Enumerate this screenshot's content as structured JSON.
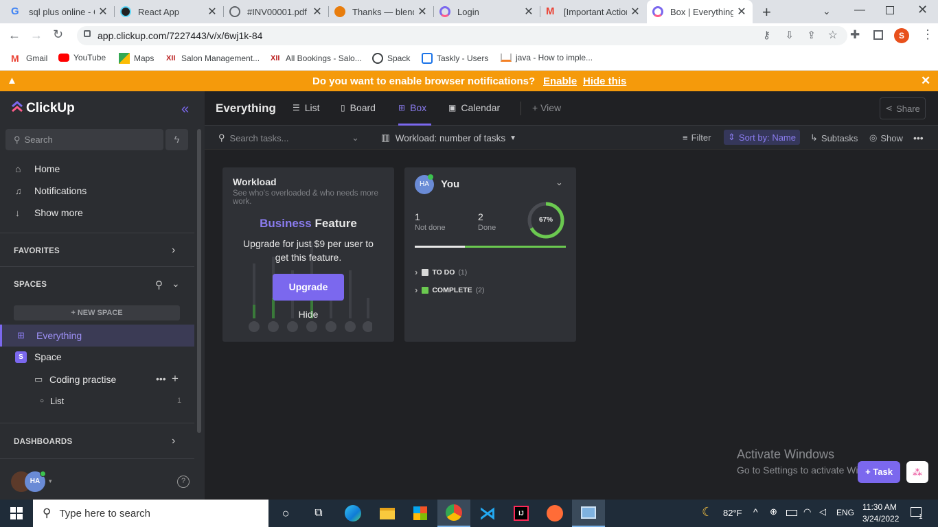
{
  "browser": {
    "tabs": [
      {
        "title": "sql plus online - C",
        "color": "#4285f4"
      },
      {
        "title": "React App",
        "color": "#61dafb"
      },
      {
        "title": "#INV00001.pdf",
        "color": "#5f6368"
      },
      {
        "title": "Thanks — blende",
        "color": "#e87d0d"
      },
      {
        "title": "Login",
        "color": "#7b68ee"
      },
      {
        "title": "[Important Action",
        "color": "#ea4335"
      },
      {
        "title": "Box | Everything |",
        "color": "#7b68ee"
      }
    ],
    "url": "app.clickup.com/7227443/v/x/6wj1k-84",
    "profile_initial": "S",
    "bookmarks": [
      "Gmail",
      "YouTube",
      "Maps",
      "Salon Management...",
      "All Bookings - Salo...",
      "Spack",
      "Taskly - Users",
      "java - How to imple..."
    ]
  },
  "banner": {
    "message": "Do you want to enable browser notifications?",
    "enable": "Enable",
    "hide": "Hide this"
  },
  "sidebar": {
    "brand": "ClickUp",
    "search_placeholder": "Search",
    "nav": [
      "Home",
      "Notifications",
      "Show more"
    ],
    "favorites": "FAVORITES",
    "spaces": "SPACES",
    "new_space": "+ NEW SPACE",
    "everything": "Everything",
    "space_badge": "S",
    "space_name": "Space",
    "folder": "Coding practise",
    "list": "List",
    "list_count": "1",
    "dashboards": "DASHBOARDS",
    "avatar": "HA"
  },
  "main": {
    "view_title": "Everything",
    "views": [
      "List",
      "Board",
      "Box",
      "Calendar"
    ],
    "add_view": "+ View",
    "share": "Share",
    "search_placeholder": "Search tasks...",
    "workload": "Workload: number of tasks",
    "filter": "Filter",
    "sort": "Sort by: Name",
    "subtasks": "Subtasks",
    "show": "Show"
  },
  "workload_card": {
    "title": "Workload",
    "subtitle": "See who's overloaded & who needs more work.",
    "business": "Business",
    "feature": "Feature",
    "upgrade_text": "Upgrade for just $9 per user to get this feature.",
    "upgrade_button": "Upgrade",
    "hide": "Hide"
  },
  "user_card": {
    "avatar": "HA",
    "name": "You",
    "not_done_count": "1",
    "not_done_label": "Not done",
    "done_count": "2",
    "done_label": "Done",
    "percent_label": "67%",
    "progress": 0.67,
    "statuses": [
      {
        "label": "TO DO",
        "count": "(1)",
        "color": "#d8d8d8"
      },
      {
        "label": "COMPLETE",
        "count": "(2)",
        "color": "#6bc950"
      }
    ]
  },
  "overlay": {
    "activate_title": "Activate Windows",
    "activate_sub": "Go to Settings to activate Windows.",
    "task_button": "+ Task"
  },
  "taskbar": {
    "search_placeholder": "Type here to search",
    "weather": "82°F",
    "lang": "ENG",
    "time": "11:30 AM",
    "date": "3/24/2022",
    "notif_count": "1"
  },
  "colors": {
    "accent": "#7b68ee",
    "banner": "#f59a0b",
    "done": "#6bc950"
  }
}
